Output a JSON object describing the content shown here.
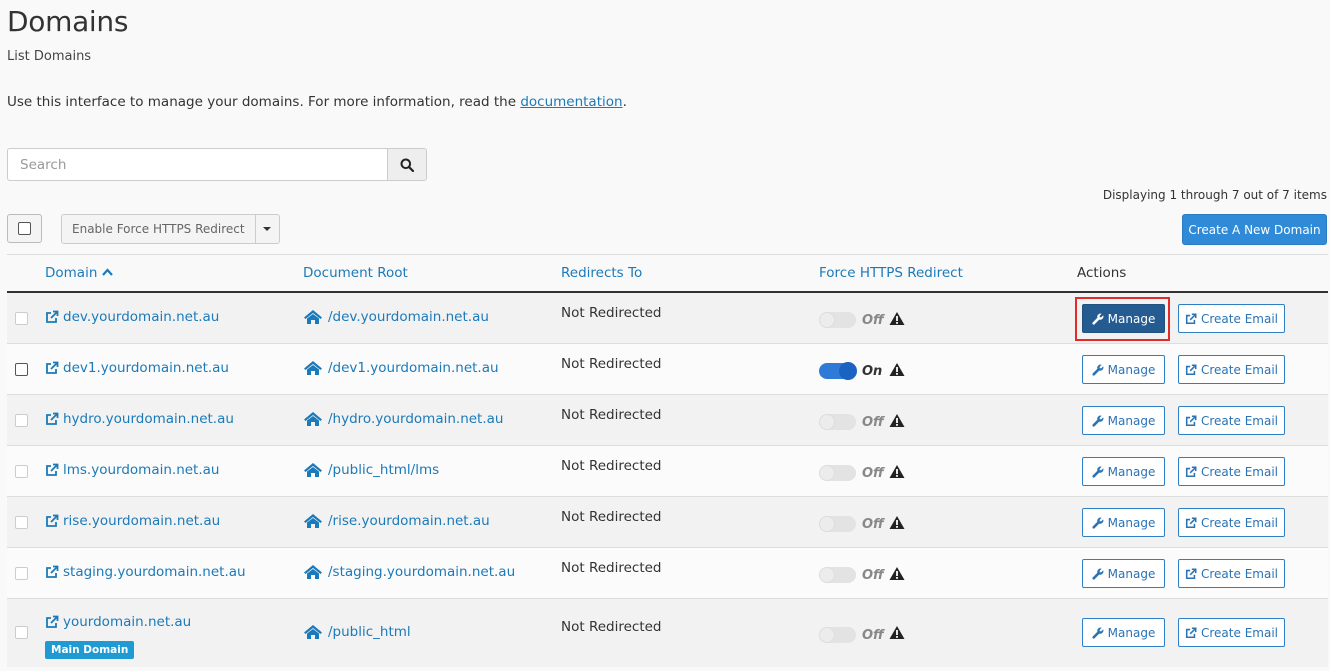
{
  "header": {
    "title": "Domains",
    "subtitle": "List Domains",
    "intro_text": "Use this interface to manage your domains. For more information, read the ",
    "intro_link": "documentation",
    "intro_end": "."
  },
  "search": {
    "placeholder": "Search"
  },
  "pagination": {
    "display_text": "Displaying 1 through 7 out of 7 items"
  },
  "toolbar": {
    "bulk_action_label": "Enable Force HTTPS Redirect",
    "create_label": "Create A New Domain"
  },
  "table": {
    "columns": {
      "domain": "Domain",
      "docroot": "Document Root",
      "redirects": "Redirects To",
      "https": "Force HTTPS Redirect",
      "actions": "Actions"
    },
    "manage_label": "Manage",
    "email_label": "Create Email",
    "rows": [
      {
        "domain": "dev.yourdomain.net.au",
        "docroot": "/dev.yourdomain.net.au",
        "redirect": "Not Redirected",
        "https": "Off"
      },
      {
        "domain": "dev1.yourdomain.net.au",
        "docroot": "/dev1.yourdomain.net.au",
        "redirect": "Not Redirected",
        "https": "On"
      },
      {
        "domain": "hydro.yourdomain.net.au",
        "docroot": "/hydro.yourdomain.net.au",
        "redirect": "Not Redirected",
        "https": "Off"
      },
      {
        "domain": "lms.yourdomain.net.au",
        "docroot": "/public_html/lms",
        "redirect": "Not Redirected",
        "https": "Off"
      },
      {
        "domain": "rise.yourdomain.net.au",
        "docroot": "/rise.yourdomain.net.au",
        "redirect": "Not Redirected",
        "https": "Off"
      },
      {
        "domain": "staging.yourdomain.net.au",
        "docroot": "/staging.yourdomain.net.au",
        "redirect": "Not Redirected",
        "https": "Off"
      },
      {
        "domain": "yourdomain.net.au",
        "docroot": "/public_html",
        "redirect": "Not Redirected",
        "https": "Off",
        "badge": "Main Domain"
      }
    ]
  },
  "colors": {
    "link": "#1b7ab9",
    "primary": "#2f8ad8",
    "manage_active": "#245c92",
    "highlight": "#e12b2b"
  }
}
